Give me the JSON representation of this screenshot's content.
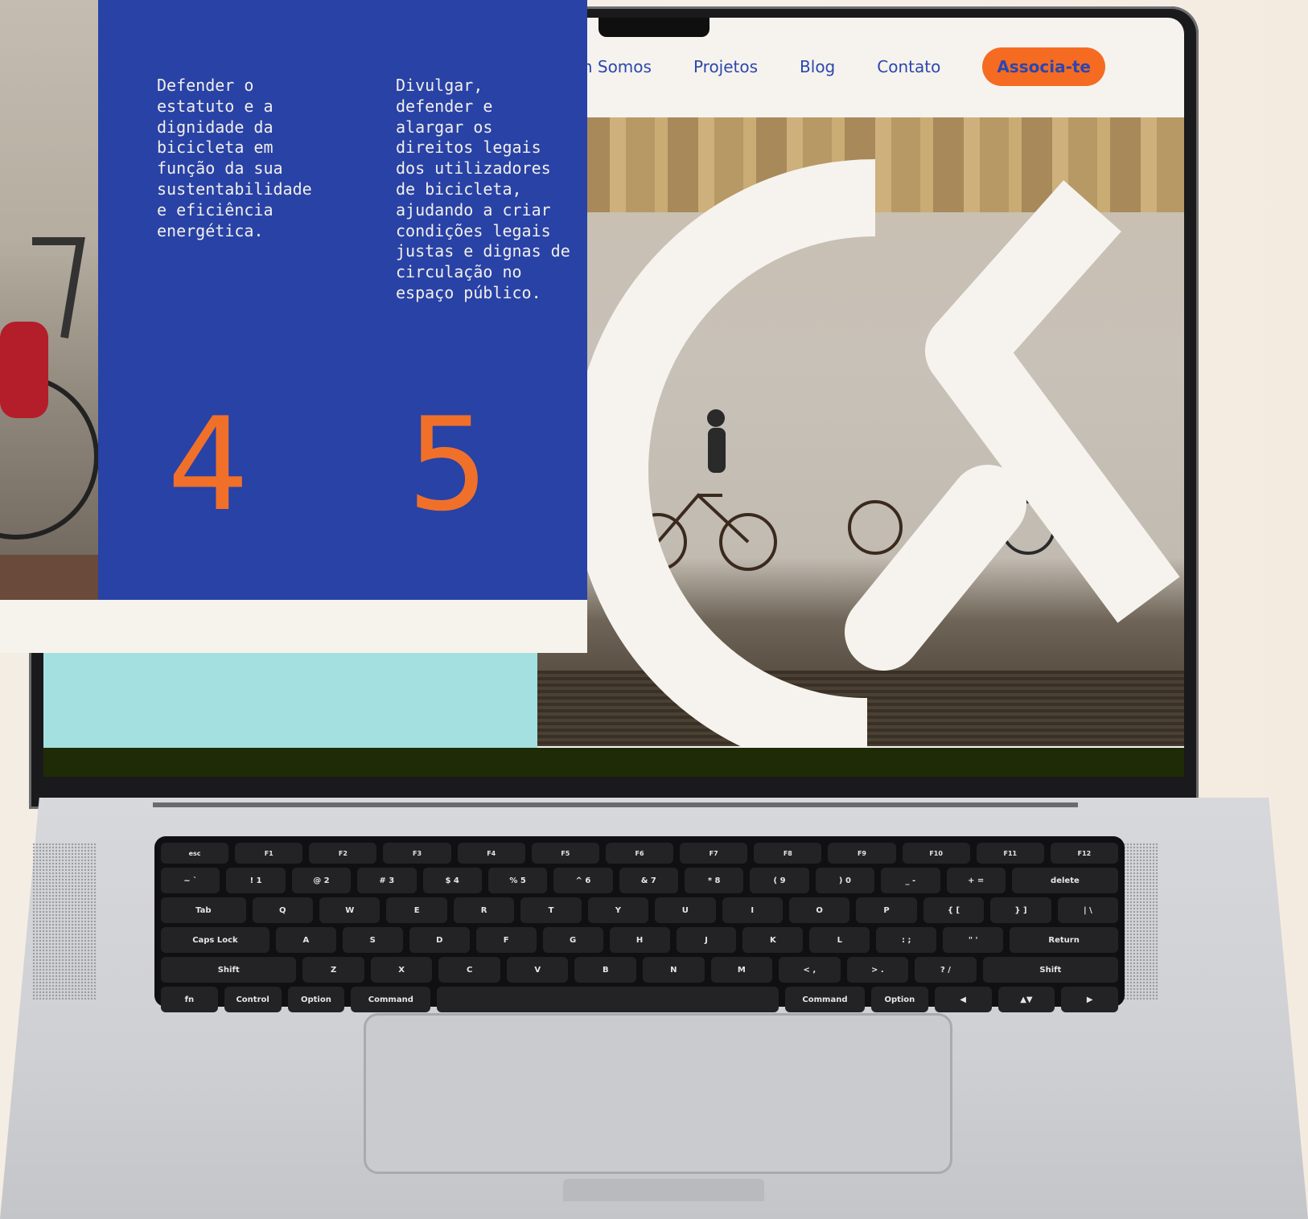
{
  "nav": {
    "items": [
      "Quem Somos",
      "Projetos",
      "Blog",
      "Contato"
    ],
    "cta": "Associa-te"
  },
  "panel": {
    "col1_text": "Defender o\nestatuto e a\ndignidade da\nbicicleta em\nfunção da sua\nsustentabilidade\ne eficiência\nenergética.",
    "col2_text": "Divulgar,\ndefender e\nalargar os\ndireitos legais\ndos utilizadores\nde bicicleta,\najudando a criar\ncondições legais\njustas e dignas de\ncirculação no\nespaço público.",
    "num1": "4",
    "num2": "5"
  },
  "keyboard": {
    "fn_row": [
      "esc",
      "F1",
      "F2",
      "F3",
      "F4",
      "F5",
      "F6",
      "F7",
      "F8",
      "F9",
      "F10",
      "F11",
      "F12"
    ],
    "num_row": [
      "~ `",
      "! 1",
      "@ 2",
      "# 3",
      "$ 4",
      "% 5",
      "^ 6",
      "& 7",
      "* 8",
      "( 9",
      ") 0",
      "_ -",
      "+ =",
      "delete"
    ],
    "q_row": [
      "Tab",
      "Q",
      "W",
      "E",
      "R",
      "T",
      "Y",
      "U",
      "I",
      "O",
      "P",
      "{ [",
      "} ]",
      "| \\"
    ],
    "a_row": [
      "Caps Lock",
      "A",
      "S",
      "D",
      "F",
      "G",
      "H",
      "J",
      "K",
      "L",
      ": ;",
      "\" '",
      "Return"
    ],
    "z_row": [
      "Shift",
      "Z",
      "X",
      "C",
      "V",
      "B",
      "N",
      "M",
      "< ,",
      "> .",
      "? /",
      "Shift"
    ],
    "bottom_row": [
      "fn",
      "Control",
      "Option",
      "Command",
      "",
      "Command",
      "Option",
      "◀",
      "▲▼",
      "▶"
    ]
  },
  "colors": {
    "blue": "#2842a6",
    "orange": "#f66b22",
    "aqua": "#a5e0e1",
    "dark_green": "#1f2b06"
  }
}
